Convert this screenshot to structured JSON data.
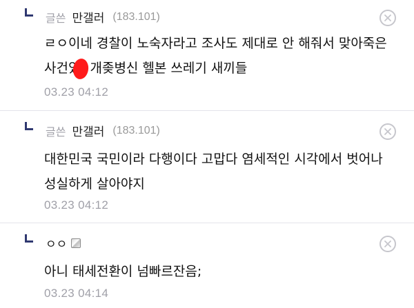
{
  "comments": [
    {
      "label": "글쓴",
      "author": "만갤러",
      "ip": "(183.101)",
      "text": "ㄹㅇ이네 경찰이 노숙자라고 조사도 제대로 안 해줘서 맞아죽은 사건있 개좆병신 헬본 쓰레기 새끼들",
      "time": "03.23 04:12"
    },
    {
      "label": "글쓴",
      "author": "만갤러",
      "ip": "(183.101)",
      "text": "대한민국 국민이라 다행이다 고맙다 염세적인 시각에서 벗어나 성실하게 살아야지",
      "time": "03.23 04:12"
    },
    {
      "author": "ㅇㅇ",
      "text": "아니 태세전환이 넘빠르잔음;",
      "time": "03.23 04:14"
    }
  ],
  "colors": {
    "reply_arrow": "#2f3870",
    "meta_gray": "#a0a0a8",
    "divider": "#e3e3ea",
    "delete_circle": "#c6c6cc",
    "blot_red": "#ff1a1a"
  },
  "icons": {
    "reply": "reply-arrow-icon",
    "delete": "delete-circle-x-icon",
    "nick": "fixed-nick-icon"
  }
}
